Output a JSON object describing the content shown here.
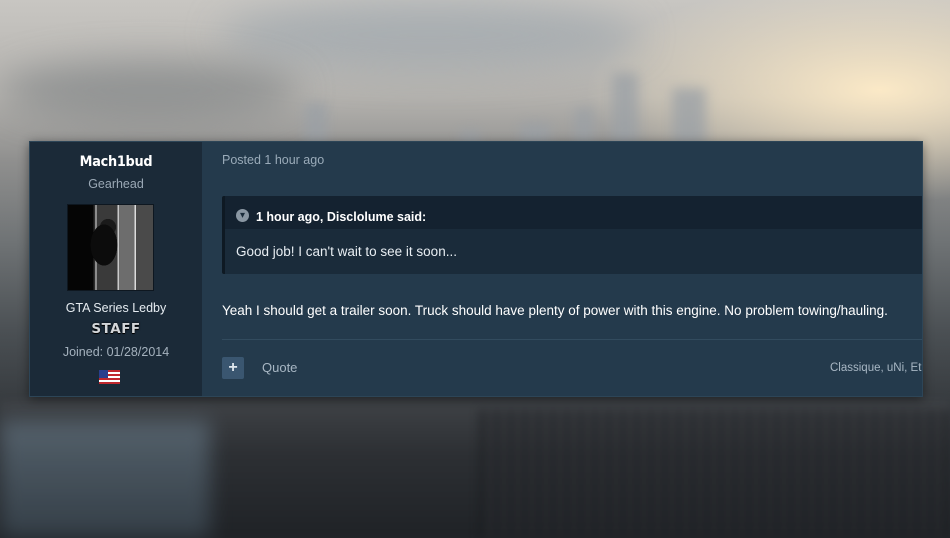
{
  "author": {
    "name": "Mach1bud",
    "title": "Gearhead",
    "group": "GTA Series Ledby",
    "badge": "STAFF",
    "joined": "Joined: 01/28/2014",
    "flag_icon": "us-flag-icon"
  },
  "post": {
    "meta": "Posted 1 hour ago",
    "quote": {
      "toggle_icon": "chevron-down-icon",
      "citation": "1 hour ago, Disclolume said:",
      "body": "Good job! I can't wait to see it soon..."
    },
    "message": "Yeah I should get a trailer soon. Truck should have plenty of power with this engine. No problem towing/hauling.",
    "actions": {
      "plus_label": "+",
      "quote_label": "Quote"
    },
    "reactors": "Classique, uNi, Et"
  },
  "colors": {
    "post_bg": "#243a4c",
    "author_bg": "#1b2a38",
    "quote_bg": "#1a2b3a"
  }
}
